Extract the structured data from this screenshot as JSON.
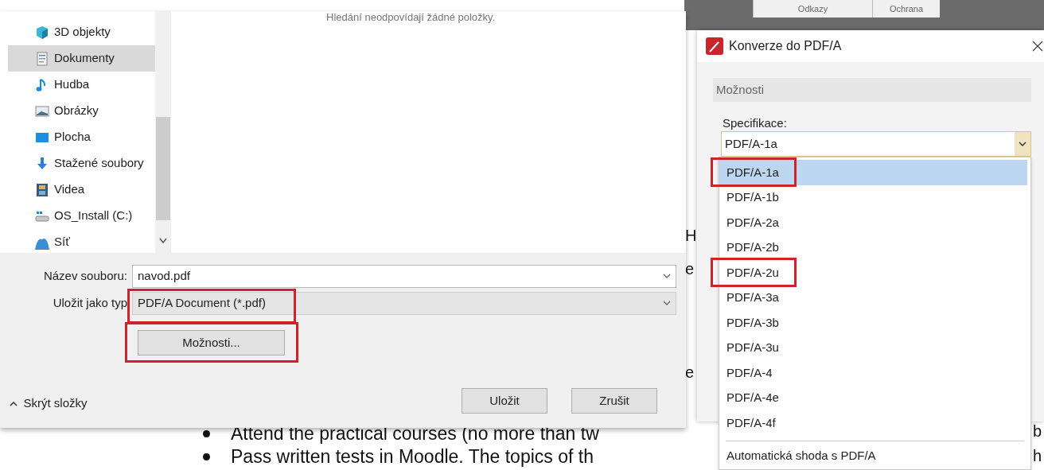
{
  "background_document": {
    "bullets": [
      "Attend the practical courses (no more than tw",
      "Pass written tests in Moodle. The topics of th"
    ],
    "fragments": [
      "H",
      "e",
      "e",
      "b",
      "h"
    ]
  },
  "behind_toolbar": {
    "tabs": [
      "Odkazy",
      "Ochrana"
    ]
  },
  "save_dialog": {
    "nav_items": [
      {
        "label": "3D objekty",
        "selected": false
      },
      {
        "label": "Dokumenty",
        "selected": true
      },
      {
        "label": "Hudba",
        "selected": false
      },
      {
        "label": "Obrázky",
        "selected": false
      },
      {
        "label": "Plocha",
        "selected": false
      },
      {
        "label": "Stažené soubory",
        "selected": false
      },
      {
        "label": "Videa",
        "selected": false
      },
      {
        "label": "OS_Install (C:)",
        "selected": false
      },
      {
        "label": "Síť",
        "selected": false
      }
    ],
    "empty_message": "Hledání neodpovídají žádné položky.",
    "file_name": {
      "label": "Název souboru:",
      "value": "navod.pdf"
    },
    "file_type": {
      "label": "Uložit jako typ",
      "value": "PDF/A Document (*.pdf)",
      "highlighted": true
    },
    "options_button": {
      "label": "Možnosti...",
      "highlighted": true
    },
    "hide_folders": "Skrýt složky",
    "buttons": [
      "Uložit",
      "Zrušit"
    ]
  },
  "pdfa_dialog": {
    "title": "Konverze do PDF/A",
    "group": "Možnosti",
    "spec_label": "Specifikace:",
    "spec_value": "PDF/A-1a",
    "options": [
      {
        "label": "PDF/A-1a",
        "selected": true,
        "highlighted": true
      },
      {
        "label": "PDF/A-1b",
        "selected": false,
        "highlighted": false
      },
      {
        "label": "PDF/A-2a",
        "selected": false,
        "highlighted": false
      },
      {
        "label": "PDF/A-2b",
        "selected": false,
        "highlighted": false
      },
      {
        "label": "PDF/A-2u",
        "selected": false,
        "highlighted": true
      },
      {
        "label": "PDF/A-3a",
        "selected": false,
        "highlighted": false
      },
      {
        "label": "PDF/A-3b",
        "selected": false,
        "highlighted": false
      },
      {
        "label": "PDF/A-3u",
        "selected": false,
        "highlighted": false
      },
      {
        "label": "PDF/A-4",
        "selected": false,
        "highlighted": false
      },
      {
        "label": "PDF/A-4e",
        "selected": false,
        "highlighted": false
      },
      {
        "label": "PDF/A-4f",
        "selected": false,
        "highlighted": false
      }
    ],
    "auto_option": "Automatická shoda s PDF/A"
  }
}
